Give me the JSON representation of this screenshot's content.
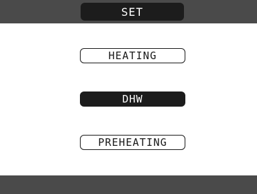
{
  "header": {
    "title": "SET"
  },
  "menu": {
    "items": [
      {
        "label": "HEATING",
        "selected": false
      },
      {
        "label": "DHW",
        "selected": true
      },
      {
        "label": "PREHEATING",
        "selected": false
      }
    ]
  },
  "colors": {
    "bar": "#4a4a4a",
    "selected_bg": "#1c1c1c",
    "background": "#ffffff",
    "text_dark": "#1a1a1a",
    "text_light": "#ffffff"
  }
}
